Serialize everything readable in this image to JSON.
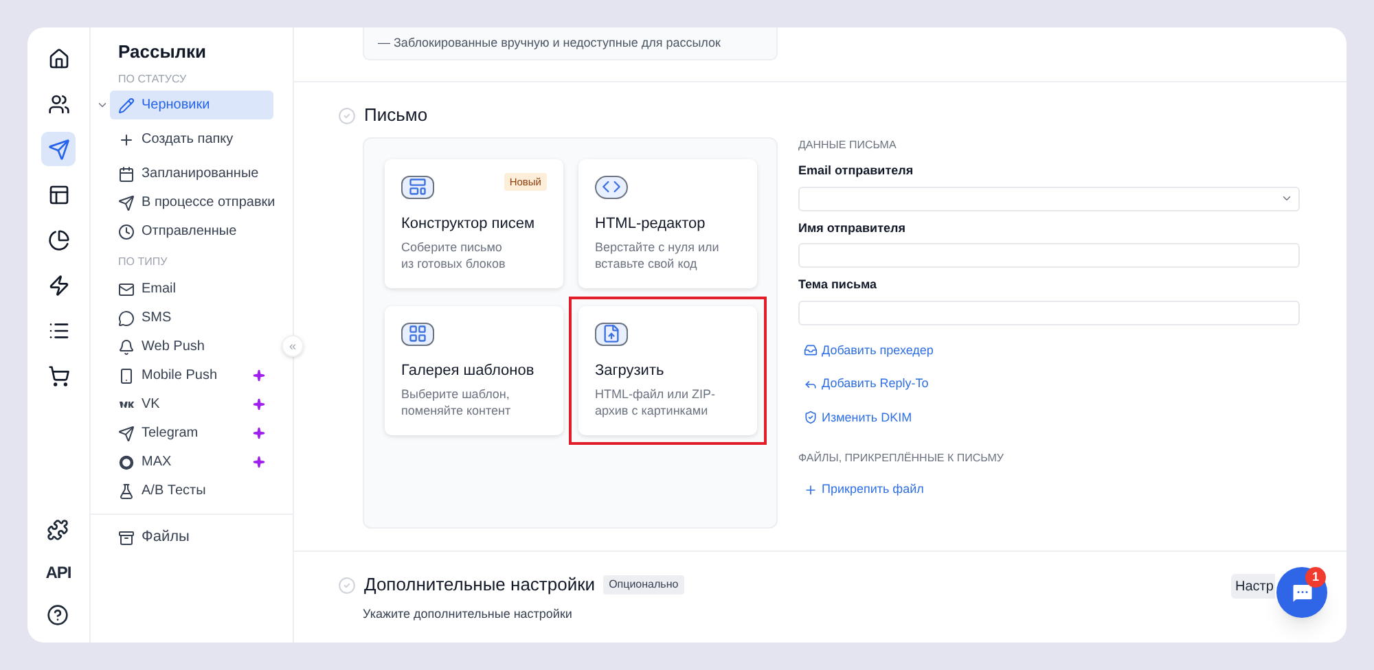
{
  "rail": {
    "items": [
      {
        "selected": false
      },
      {
        "selected": false
      },
      {
        "selected": true
      },
      {
        "selected": false
      },
      {
        "selected": false
      },
      {
        "selected": false
      },
      {
        "selected": false
      },
      {
        "selected": false
      }
    ],
    "api_label": "API"
  },
  "sidebar": {
    "title": "Рассылки",
    "collapse_label": "«",
    "sections": [
      {
        "heading": "ПО СТАТУСУ",
        "items": [
          {
            "kind": "folder",
            "label": "Черновики",
            "selected": true,
            "expanded": true,
            "pro": false
          },
          {
            "kind": "action",
            "label": "Создать папку",
            "selected": false,
            "pro": false
          },
          {
            "kind": "item",
            "label": "Запланированные",
            "selected": false,
            "pro": false
          },
          {
            "kind": "item",
            "label": "В процессе отправки",
            "selected": false,
            "pro": false
          },
          {
            "kind": "item",
            "label": "Отправленные",
            "selected": false,
            "pro": false
          }
        ]
      },
      {
        "heading": "ПО ТИПУ",
        "items": [
          {
            "kind": "item",
            "label": "Email",
            "selected": false,
            "pro": false
          },
          {
            "kind": "item",
            "label": "SMS",
            "selected": false,
            "pro": false
          },
          {
            "kind": "item",
            "label": "Web Push",
            "selected": false,
            "pro": false
          },
          {
            "kind": "item",
            "label": "Mobile Push",
            "selected": false,
            "pro": true
          },
          {
            "kind": "item",
            "label": "VK",
            "selected": false,
            "pro": true
          },
          {
            "kind": "item",
            "label": "Telegram",
            "selected": false,
            "pro": true
          },
          {
            "kind": "item",
            "label": "MAX",
            "selected": false,
            "pro": true
          },
          {
            "kind": "item",
            "label": "A/B Тесты",
            "selected": false,
            "pro": false
          }
        ]
      }
    ],
    "footer_item": {
      "label": "Файлы",
      "selected": false
    }
  },
  "top_note": "— Заблокированные вручную и недоступные для рассылок",
  "letter": {
    "title": "Письмо",
    "done": false,
    "cards": [
      {
        "title": "Конструктор писем",
        "description": "Соберите письмо\nиз готовых блоков",
        "badge": "Новый",
        "highlighted": false
      },
      {
        "title": "HTML-редактор",
        "description": "Верстайте с нуля или\nвставьте свой код",
        "highlighted": false
      },
      {
        "title": "Галерея шаблонов",
        "description": "Выберите шаблон,\nпоменяйте контент",
        "highlighted": false
      },
      {
        "title": "Загрузить",
        "description": "HTML-файл или ZIP-\nархив с картинками",
        "highlighted": true
      }
    ],
    "form": {
      "heading": "ДАННЫЕ ПИСЬМА",
      "fields": [
        {
          "label": "Email отправителя",
          "kind": "select"
        },
        {
          "label": "Имя отправителя",
          "kind": "text"
        },
        {
          "label": "Тема письма",
          "kind": "text"
        }
      ],
      "links": [
        "Добавить прехедер",
        "Добавить Reply-To",
        "Изменить DKIM"
      ],
      "files_heading": "ФАЙЛЫ, ПРИКРЕПЛЁННЫЕ К ПИСЬМУ",
      "attach_label": "Прикрепить файл"
    }
  },
  "extra": {
    "title": "Дополнительные настройки",
    "done": false,
    "badge": "Опционально",
    "hint": "Укажите дополнительные настройки",
    "button": "Настр"
  },
  "chat": {
    "unread": "1"
  }
}
